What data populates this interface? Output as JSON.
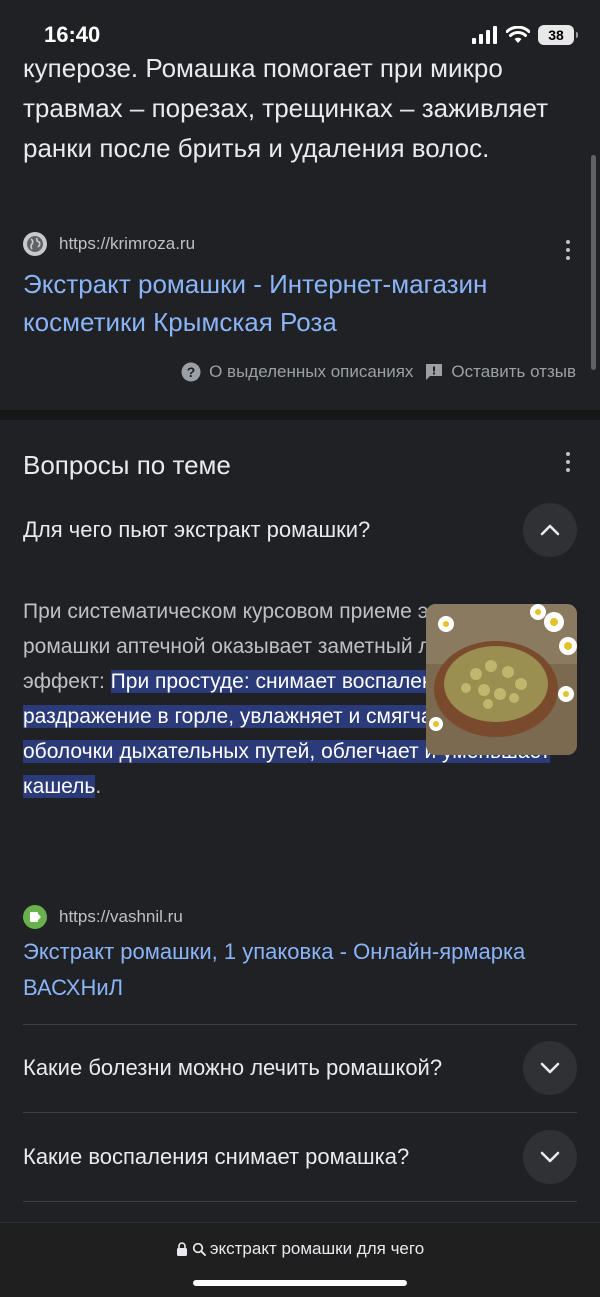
{
  "status_bar": {
    "time": "16:40",
    "battery": "38"
  },
  "top_result": {
    "snippet": "куперозе. Ромашка помогает при микро травмах – порезах, трещинках – заживляет ранки после бритья и удаления волос.",
    "source_url": "https://krimroza.ru",
    "title": "Экстракт ромашки - Интернет-магазин косметики Крымская Роза",
    "about_featured": "О выделенных описаниях",
    "leave_feedback": "Оставить отзыв"
  },
  "questions": {
    "section_title": "Вопросы по теме",
    "expanded": {
      "question": "Для чего пьют экстракт ромашки?",
      "answer_plain": "При систематическом курсовом приеме экстракт ромашки аптечной оказывает заметный лечебный эффект: ",
      "answer_highlight": "При простуде: снимает воспаление, боли и раздражение в горле, увлажняет и смягчает слизистые оболочки дыхательных путей, облегчает и уменьшает кашель",
      "answer_end": ".",
      "source_url": "https://vashnil.ru",
      "source_title": "Экстракт ромашки, 1 упаковка - Онлайн-ярмарка ВАСХНиЛ"
    },
    "collapsed": [
      {
        "question": "Какие болезни можно лечить ромашкой?"
      },
      {
        "question": "Какие воспаления снимает ромашка?"
      }
    ]
  },
  "address_bar": {
    "query": "экстракт ромашки для чего"
  },
  "icons": {
    "signal": "signal-icon",
    "wifi": "wifi-icon",
    "globe": "globe-icon",
    "help": "help-icon",
    "feedback": "feedback-icon",
    "chevron_up": "chevron-up-icon",
    "chevron_down": "chevron-down-icon",
    "lock": "lock-icon",
    "search": "search-icon"
  }
}
